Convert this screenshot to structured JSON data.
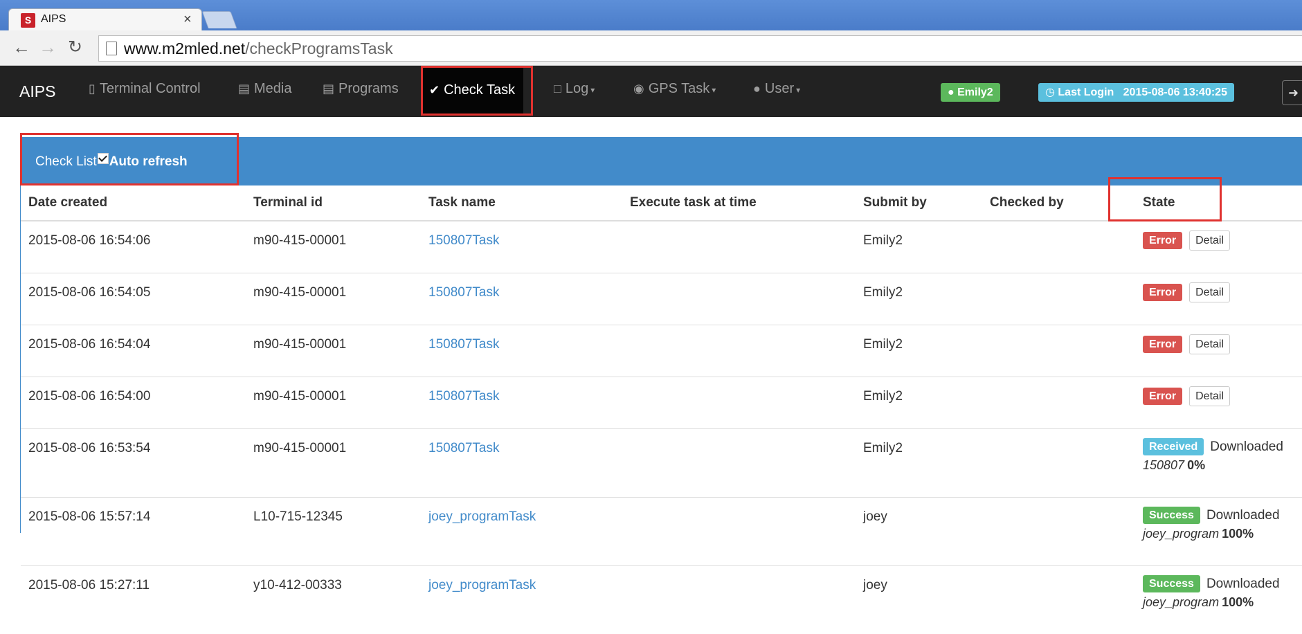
{
  "browser": {
    "tab_title": "AIPS",
    "tab_close": "×",
    "url_host": "www.m2mled.net",
    "url_path": "/checkProgramsTask"
  },
  "navbar": {
    "brand": "AIPS",
    "items": [
      {
        "label": "Terminal Control",
        "icon": "phone-icon",
        "caret": false
      },
      {
        "label": "Media",
        "icon": "hdd-icon",
        "caret": false
      },
      {
        "label": "Programs",
        "icon": "hdd-icon",
        "caret": false
      },
      {
        "label": "Check Task",
        "icon": "check-circle-icon",
        "caret": false,
        "active": true
      },
      {
        "label": "Log",
        "icon": "file-icon",
        "caret": true
      },
      {
        "label": "GPS Task",
        "icon": "globe-icon",
        "caret": true
      },
      {
        "label": "User",
        "icon": "user-icon",
        "caret": true
      }
    ],
    "user_badge": "Emily2",
    "last_login_label": "Last Login",
    "last_login_time": "2015-08-06 13:40:25"
  },
  "panel": {
    "title": "Check List",
    "auto_refresh_label": "Auto refresh",
    "auto_refresh_checked": true
  },
  "table": {
    "headers": [
      "Date created",
      "Terminal id",
      "Task name",
      "Execute task at time",
      "Submit by",
      "Checked by",
      "State"
    ],
    "detail_label": "Detail",
    "downloaded_label": "Downloaded",
    "rows": [
      {
        "date": "2015-08-06 16:54:06",
        "terminal": "m90-415-00001",
        "task": "150807Task",
        "execute": "",
        "submit": "Emily2",
        "checked": "",
        "state": "Error"
      },
      {
        "date": "2015-08-06 16:54:05",
        "terminal": "m90-415-00001",
        "task": "150807Task",
        "execute": "",
        "submit": "Emily2",
        "checked": "",
        "state": "Error"
      },
      {
        "date": "2015-08-06 16:54:04",
        "terminal": "m90-415-00001",
        "task": "150807Task",
        "execute": "",
        "submit": "Emily2",
        "checked": "",
        "state": "Error"
      },
      {
        "date": "2015-08-06 16:54:00",
        "terminal": "m90-415-00001",
        "task": "150807Task",
        "execute": "",
        "submit": "Emily2",
        "checked": "",
        "state": "Error"
      },
      {
        "date": "2015-08-06 16:53:54",
        "terminal": "m90-415-00001",
        "task": "150807Task",
        "execute": "",
        "submit": "Emily2",
        "checked": "",
        "state": "Received",
        "program": "150807",
        "progress": "0%"
      },
      {
        "date": "2015-08-06 15:57:14",
        "terminal": "L10-715-12345",
        "task": "joey_programTask",
        "execute": "",
        "submit": "joey",
        "checked": "",
        "state": "Success",
        "program": "joey_program",
        "progress": "100%"
      },
      {
        "date": "2015-08-06 15:27:11",
        "terminal": "y10-412-00333",
        "task": "joey_programTask",
        "execute": "",
        "submit": "joey",
        "checked": "",
        "state": "Success",
        "program": "joey_program",
        "progress": "100%"
      }
    ]
  },
  "colors": {
    "navbar_bg": "#222222",
    "panel_primary": "#428bca",
    "error": "#d9534f",
    "received": "#5bc0de",
    "success": "#5cb85c",
    "highlight_box": "#e0322f"
  }
}
